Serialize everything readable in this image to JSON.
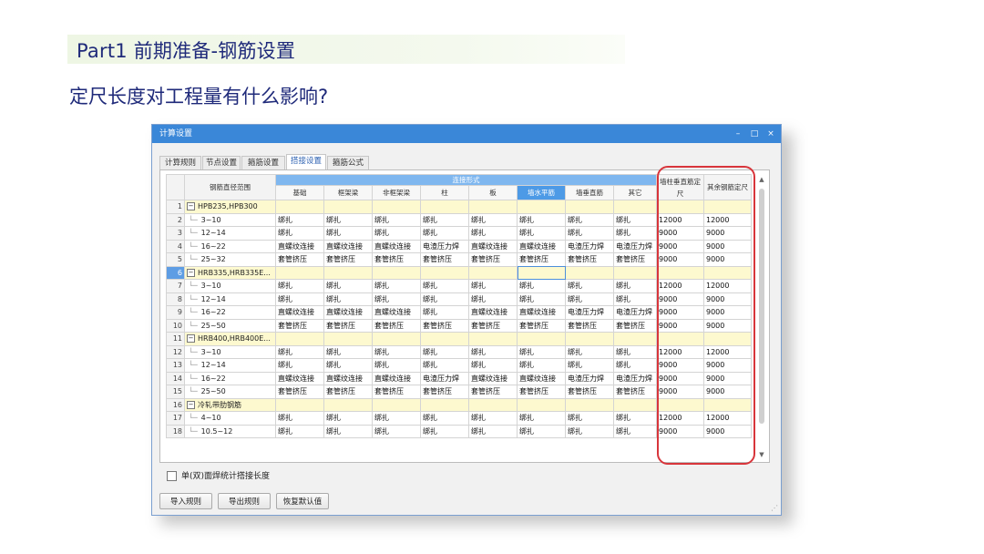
{
  "slide": {
    "title": "Part1 前期准备-钢筋设置",
    "subtitle": "定尺长度对工程量有什么影响?"
  },
  "window": {
    "title": "计算设置",
    "controls": [
      "–",
      "□",
      "×"
    ]
  },
  "tabs": [
    "计算规则",
    "节点设置",
    "箍筋设置",
    "搭接设置",
    "箍筋公式"
  ],
  "active_tab": "搭接设置",
  "table": {
    "col_range_header": "钢筋直径范围",
    "group_header": "连接形式",
    "sub_headers": [
      "基础",
      "框架梁",
      "非框架梁",
      "柱",
      "板",
      "墙水平筋",
      "墙垂直筋",
      "其它"
    ],
    "selected_sub_header": "墙水平筋",
    "fixed_len_headers": [
      "墙柱垂直筋定尺",
      "其余钢筋定尺"
    ],
    "rows": [
      {
        "n": "1",
        "group": true,
        "name": "HPB235,HPB300",
        "cells": [
          "",
          "",
          "",
          "",
          "",
          "",
          "",
          "",
          "",
          ""
        ]
      },
      {
        "n": "2",
        "name": "3~10",
        "cells": [
          "绑扎",
          "绑扎",
          "绑扎",
          "绑扎",
          "绑扎",
          "绑扎",
          "绑扎",
          "绑扎",
          "12000",
          "12000"
        ]
      },
      {
        "n": "3",
        "name": "12~14",
        "cells": [
          "绑扎",
          "绑扎",
          "绑扎",
          "绑扎",
          "绑扎",
          "绑扎",
          "绑扎",
          "绑扎",
          "9000",
          "9000"
        ]
      },
      {
        "n": "4",
        "name": "16~22",
        "cells": [
          "直螺纹连接",
          "直螺纹连接",
          "直螺纹连接",
          "电渣压力焊",
          "直螺纹连接",
          "直螺纹连接",
          "电渣压力焊",
          "电渣压力焊",
          "9000",
          "9000"
        ]
      },
      {
        "n": "5",
        "name": "25~32",
        "cells": [
          "套管挤压",
          "套管挤压",
          "套管挤压",
          "套管挤压",
          "套管挤压",
          "套管挤压",
          "套管挤压",
          "套管挤压",
          "9000",
          "9000"
        ]
      },
      {
        "n": "6",
        "group": true,
        "highlight": true,
        "name": "HRB335,HRB335E...",
        "cells": [
          "",
          "",
          "",
          "",
          "",
          "",
          "",
          "",
          "",
          ""
        ]
      },
      {
        "n": "7",
        "name": "3~10",
        "cells": [
          "绑扎",
          "绑扎",
          "绑扎",
          "绑扎",
          "绑扎",
          "绑扎",
          "绑扎",
          "绑扎",
          "12000",
          "12000"
        ]
      },
      {
        "n": "8",
        "name": "12~14",
        "cells": [
          "绑扎",
          "绑扎",
          "绑扎",
          "绑扎",
          "绑扎",
          "绑扎",
          "绑扎",
          "绑扎",
          "9000",
          "9000"
        ]
      },
      {
        "n": "9",
        "name": "16~22",
        "cells": [
          "直螺纹连接",
          "直螺纹连接",
          "直螺纹连接",
          "绑扎",
          "直螺纹连接",
          "直螺纹连接",
          "电渣压力焊",
          "电渣压力焊",
          "9000",
          "9000"
        ]
      },
      {
        "n": "10",
        "name": "25~50",
        "cells": [
          "套管挤压",
          "套管挤压",
          "套管挤压",
          "套管挤压",
          "套管挤压",
          "套管挤压",
          "套管挤压",
          "套管挤压",
          "9000",
          "9000"
        ]
      },
      {
        "n": "11",
        "group": true,
        "name": "HRB400,HRB400E...",
        "cells": [
          "",
          "",
          "",
          "",
          "",
          "",
          "",
          "",
          "",
          ""
        ]
      },
      {
        "n": "12",
        "name": "3~10",
        "cells": [
          "绑扎",
          "绑扎",
          "绑扎",
          "绑扎",
          "绑扎",
          "绑扎",
          "绑扎",
          "绑扎",
          "12000",
          "12000"
        ]
      },
      {
        "n": "13",
        "name": "12~14",
        "cells": [
          "绑扎",
          "绑扎",
          "绑扎",
          "绑扎",
          "绑扎",
          "绑扎",
          "绑扎",
          "绑扎",
          "9000",
          "9000"
        ]
      },
      {
        "n": "14",
        "name": "16~22",
        "cells": [
          "直螺纹连接",
          "直螺纹连接",
          "直螺纹连接",
          "电渣压力焊",
          "直螺纹连接",
          "直螺纹连接",
          "电渣压力焊",
          "电渣压力焊",
          "9000",
          "9000"
        ]
      },
      {
        "n": "15",
        "name": "25~50",
        "cells": [
          "套管挤压",
          "套管挤压",
          "套管挤压",
          "套管挤压",
          "套管挤压",
          "套管挤压",
          "套管挤压",
          "套管挤压",
          "9000",
          "9000"
        ]
      },
      {
        "n": "16",
        "group": true,
        "name": "冷轧带肋钢筋",
        "cells": [
          "",
          "",
          "",
          "",
          "",
          "",
          "",
          "",
          "",
          ""
        ]
      },
      {
        "n": "17",
        "name": "4~10",
        "cells": [
          "绑扎",
          "绑扎",
          "绑扎",
          "绑扎",
          "绑扎",
          "绑扎",
          "绑扎",
          "绑扎",
          "12000",
          "12000"
        ]
      },
      {
        "n": "18",
        "name": "10.5~12",
        "cells": [
          "绑扎",
          "绑扎",
          "绑扎",
          "绑扎",
          "绑扎",
          "绑扎",
          "绑扎",
          "绑扎",
          "9000",
          "9000"
        ]
      }
    ]
  },
  "checkbox_label": "单(双)面焊统计搭接长度",
  "buttons": [
    "导入规则",
    "导出规则",
    "恢复默认值"
  ],
  "colors": {
    "title_text": "#1f2a7a",
    "titlebar": "#3a87d8",
    "group_row": "#fdf9cf",
    "highlight_box": "#d8353b"
  }
}
